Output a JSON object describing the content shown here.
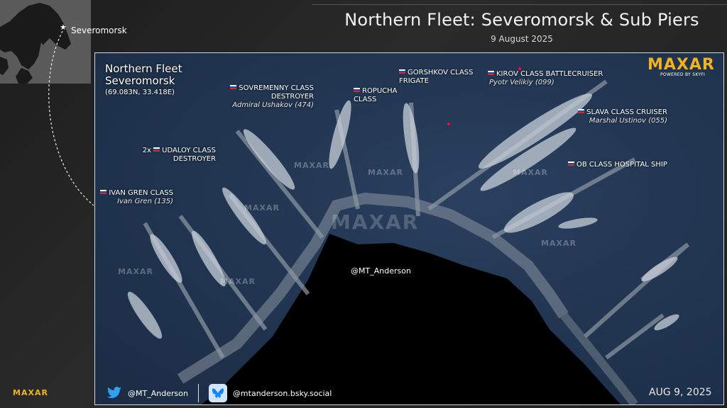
{
  "header": {
    "title": "Northern Fleet: Severomorsk & Sub Piers",
    "date": "9 August 2025"
  },
  "inset": {
    "place_label": "Severomorsk",
    "marker_icon": "star-icon"
  },
  "scene": {
    "location_title": "Northern Fleet\nSeveromorsk",
    "location_coords": "(69.083N, 33.418E)",
    "center_credit": "@MT_Anderson",
    "watermark": "MAXAR",
    "labels": {
      "sovremenny_class": "SOVREMENNY CLASS\nDESTROYER",
      "sovremenny_name": "Admiral Ushakov (474)",
      "ropucha": "ROPUCHA\nCLASS",
      "gorshkov": "GORSHKOV CLASS\nFRIGATE",
      "kirov_class": "KIROV CLASS BATTLECRUISER",
      "kirov_name": "Pyotr Velikiy (099)",
      "slava_class": "SLAVA CLASS CRUISER",
      "slava_name": "Marshal Ustinov (055)",
      "udaloy_prefix": "2x",
      "udaloy": "UDALOY CLASS\nDESTROYER",
      "ivan_gren_class": "IVAN GREN CLASS",
      "ivan_gren_name": "Ivan Gren (135)",
      "ob_class": "OB CLASS HOSPITAL SHIP"
    }
  },
  "logo": {
    "word": "MAXAR",
    "powered": "POWERED BY SKYFI"
  },
  "footer": {
    "maxar": "MAXAR",
    "twitter_handle": "@MT_Anderson",
    "bsky_handle": "@mtanderson.bsky.social",
    "date": "AUG 9, 2025"
  },
  "colors": {
    "maxar_orange": "#f6b21a",
    "frame": "#cfd6de"
  }
}
